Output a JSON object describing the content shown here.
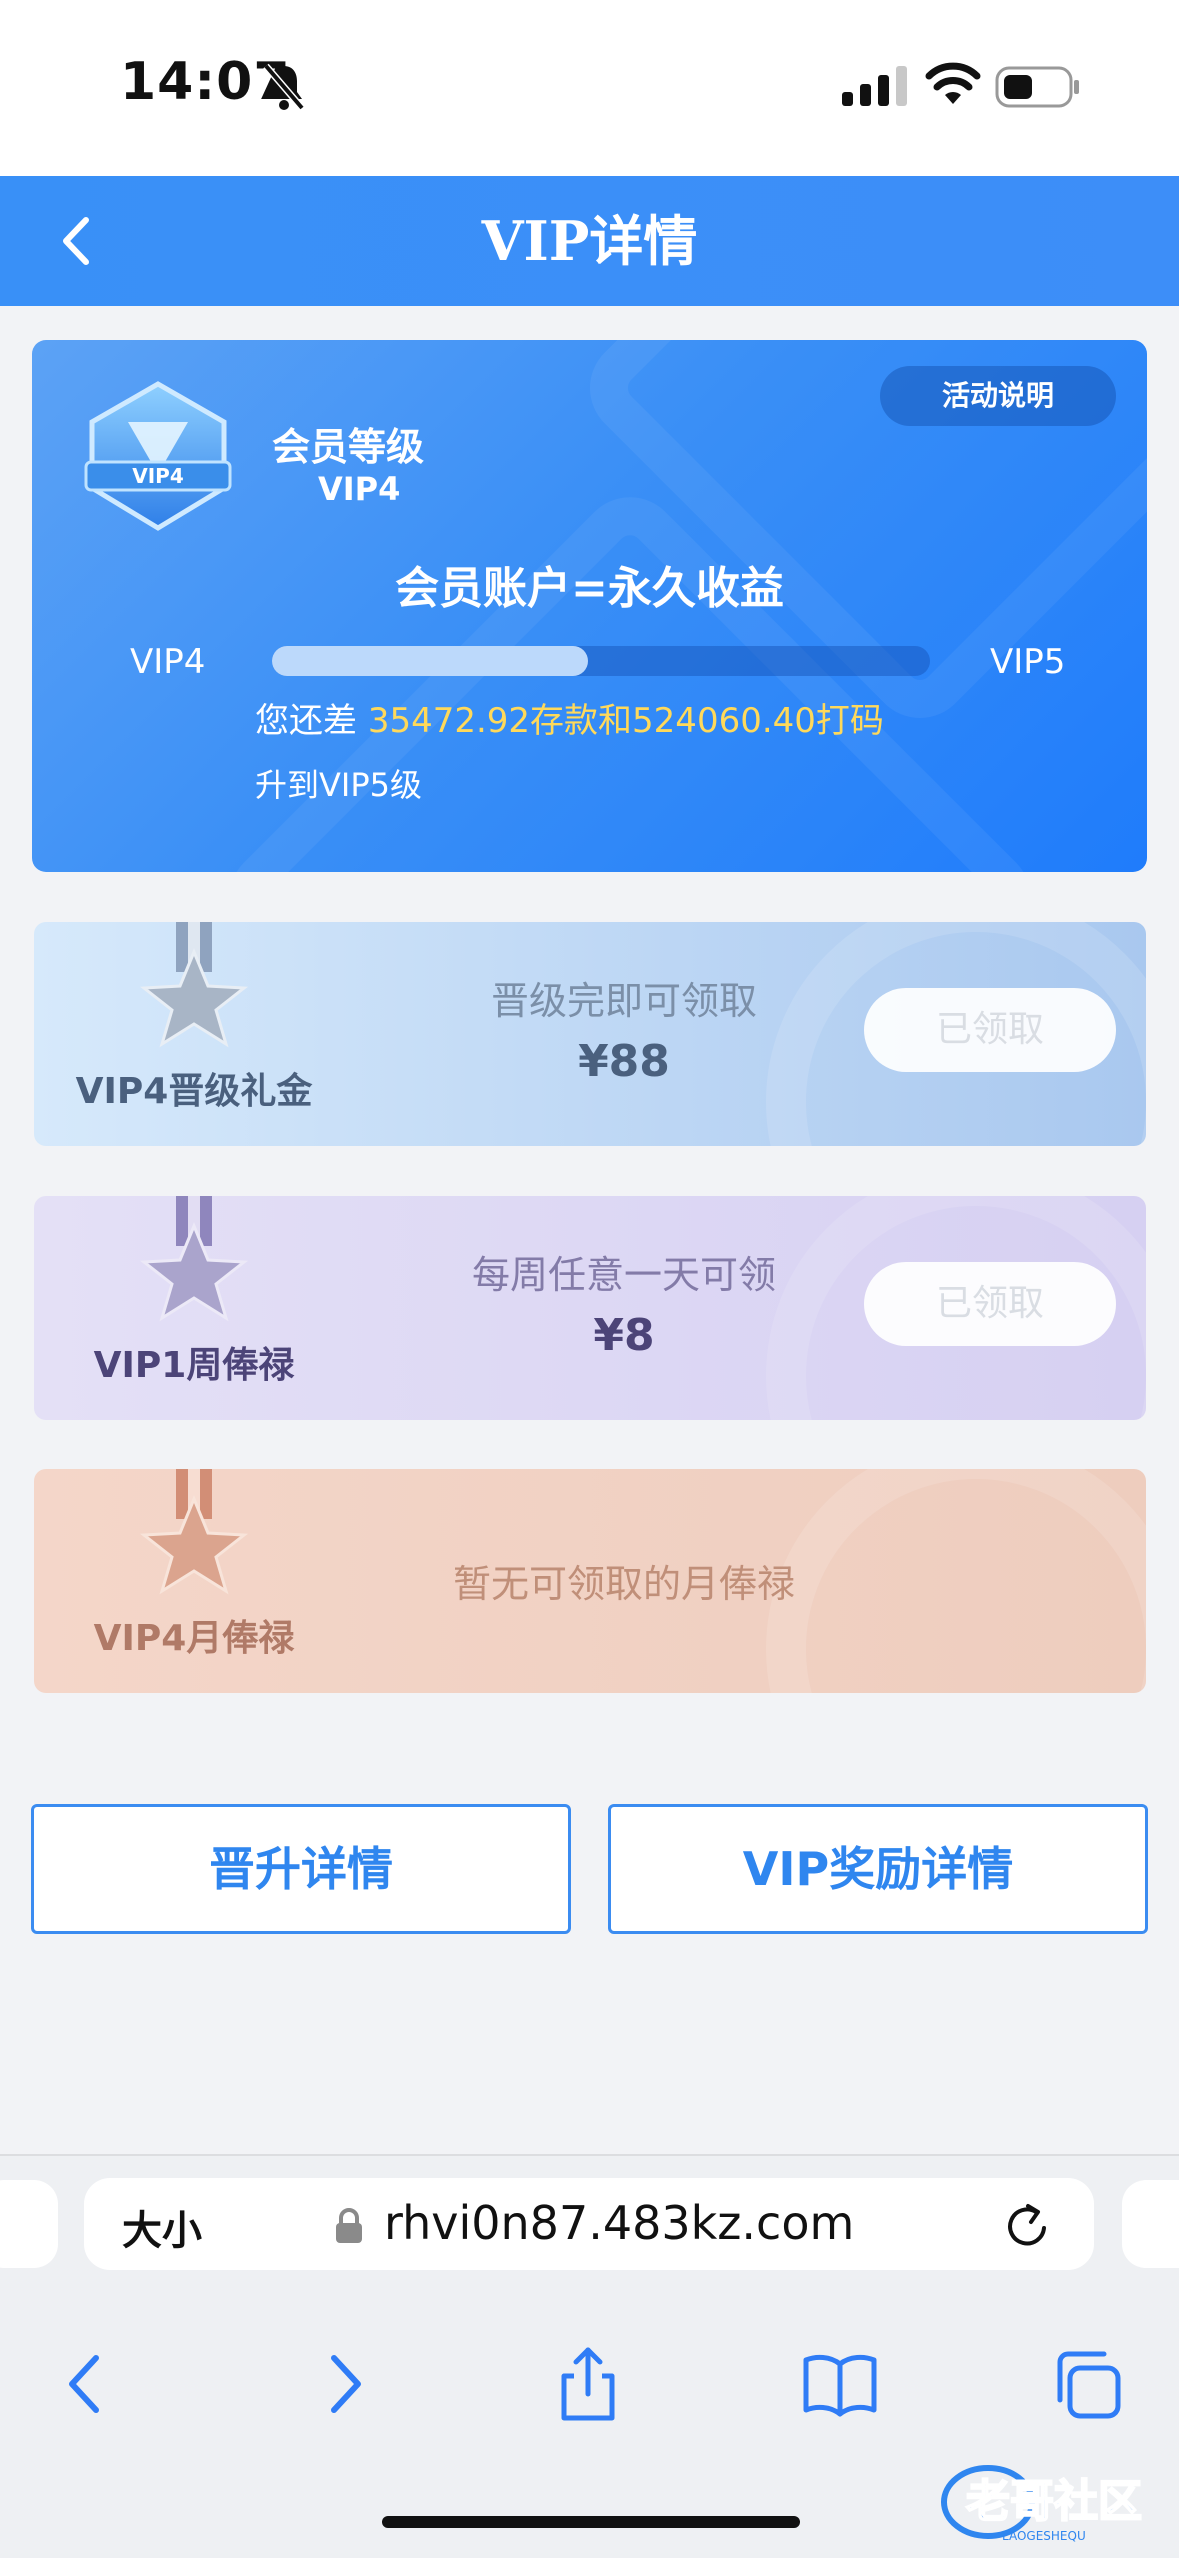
{
  "status_bar": {
    "time": "14:07"
  },
  "header": {
    "title": "VIP详情"
  },
  "vip_card": {
    "badge_text": "VIP4",
    "level_label": "会员等级",
    "level_value": "VIP4",
    "activity_label": "活动说明",
    "slogan": "会员账户=永久收益",
    "current_level": "VIP4",
    "next_level": "VIP5",
    "progress": 0.48,
    "upgrade_prefix": "您还差 ",
    "upgrade_highlight": "35472.92存款和524060.40打码",
    "upgrade_suffix": "升到VIP5级"
  },
  "rewards": [
    {
      "name": "VIP4晋级礼金",
      "desc": "晋级完即可领取",
      "amount": "¥88",
      "button": "已领取",
      "accent": "#4a607e",
      "desc_color": "#7b8fa8",
      "medal_color": "#a9b6c6"
    },
    {
      "name": "VIP1周俸禄",
      "desc": "每周任意一天可领",
      "amount": "¥8",
      "button": "已领取",
      "accent": "#4c4478",
      "desc_color": "#837ba8",
      "medal_color": "#aaa4cc"
    },
    {
      "name": "VIP4月俸禄",
      "desc": "暂无可领取的月俸禄",
      "amount": "",
      "button": "",
      "accent": "#b07a67",
      "desc_color": "#c08f79",
      "medal_color": "#dba48e"
    }
  ],
  "actions": {
    "promotion_details": "晋升详情",
    "vip_rewards_details": "VIP奖励详情"
  },
  "browser": {
    "text_size_label": "大小",
    "url": "rhvi0n87.483kz.com"
  },
  "watermark": {
    "text": "老哥社区",
    "subtext": "LAOGESHEQU"
  },
  "colors": {
    "primary": "#3b8ff6",
    "highlight": "#ffd95a"
  }
}
